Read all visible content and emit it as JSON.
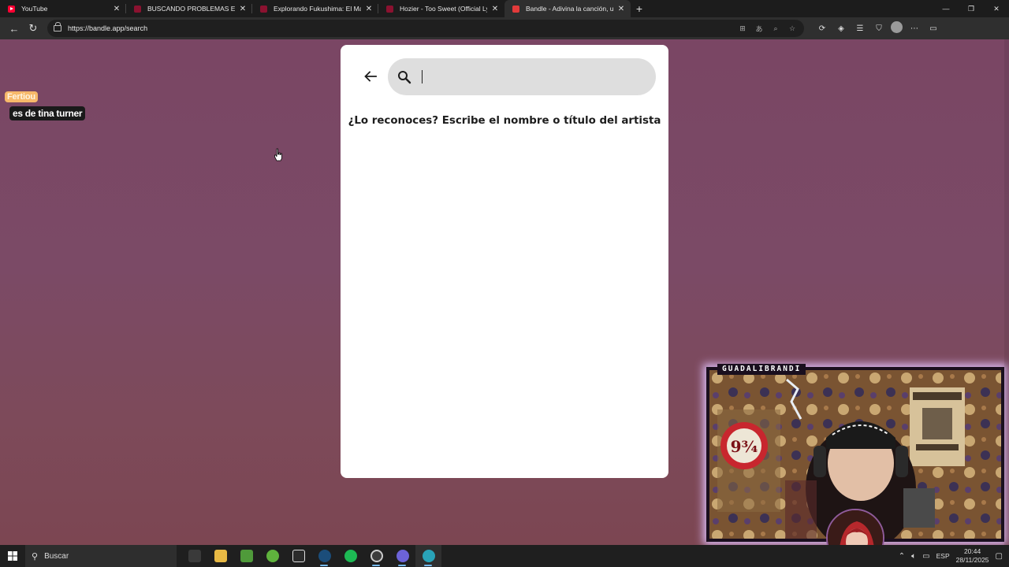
{
  "browser": {
    "tabs": [
      {
        "title": "YouTube",
        "favicon": "youtube-icon",
        "active": false
      },
      {
        "title": "BUSCANDO PROBLEMAS EN LINEA",
        "favicon": "youtube-icon",
        "active": false
      },
      {
        "title": "Explorando Fukushima: El Mayor",
        "favicon": "youtube-icon",
        "active": false
      },
      {
        "title": "Hozier - Too Sweet (Official Lyric V",
        "favicon": "youtube-icon",
        "active": false
      },
      {
        "title": "Bandle - Adivina la canción, un ins",
        "favicon": "bandle-icon",
        "active": true
      }
    ],
    "url": "https://bandle.app/search"
  },
  "chat": {
    "username": "Fertiou",
    "message": "es de tina turner"
  },
  "bandle": {
    "search_placeholder": "",
    "search_value": "",
    "prompt": "¿Lo reconoces? Escribe el nombre o título del artista"
  },
  "webcam": {
    "channel_label": "GUADALIBRANDI"
  },
  "taskbar": {
    "search_label": "Buscar",
    "language": "ESP",
    "time": "20:44",
    "date": "28/11/2025",
    "apps": [
      "files-icon",
      "folder-icon",
      "minecraft-icon",
      "xbox-icon",
      "epic-games-icon",
      "steam-icon",
      "spotify-icon",
      "obs-icon",
      "discord-icon",
      "edge-icon"
    ]
  },
  "colors": {
    "page_background": "#7b4a66",
    "card": "#ffffff",
    "search_box": "#dedede",
    "chat_name_bg": "#f7b96a",
    "webcam_glow": "#d8b7f0"
  }
}
